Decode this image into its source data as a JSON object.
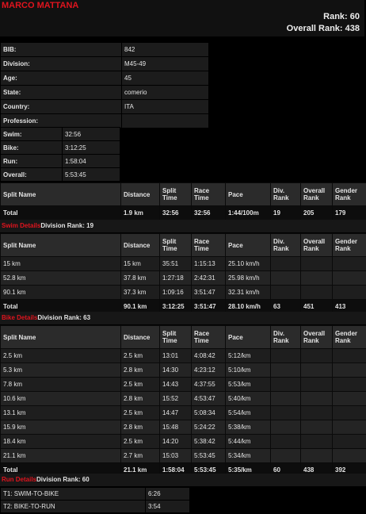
{
  "athlete": {
    "name": "MARCO MATTANA",
    "rank_label": "Rank: 60",
    "overall_rank_label": "Overall Rank: 438"
  },
  "info": [
    {
      "k": "BIB:",
      "v": "842"
    },
    {
      "k": "Division:",
      "v": "M45-49"
    },
    {
      "k": "Age:",
      "v": "45"
    },
    {
      "k": "State:",
      "v": "comerio"
    },
    {
      "k": "Country:",
      "v": "ITA"
    },
    {
      "k": "Profession:",
      "v": ""
    }
  ],
  "summary": [
    {
      "k": "Swim:",
      "v": "32:56"
    },
    {
      "k": "Bike:",
      "v": "3:12:25"
    },
    {
      "k": "Run:",
      "v": "1:58:04"
    },
    {
      "k": "Overall:",
      "v": "5:53:45"
    }
  ],
  "headers": {
    "split": "Split Name",
    "dist": "Distance",
    "stime": "Split Time",
    "rtime": "Race Time",
    "pace": "Pace",
    "div": "Div. Rank",
    "ovr": "Overall Rank",
    "gen": "Gender Rank"
  },
  "swim": {
    "rows": [],
    "total": [
      "Total",
      "1.9 km",
      "32:56",
      "32:56",
      "1:44/100m",
      "19",
      "205",
      "179"
    ]
  },
  "bike": {
    "link": "Swim Details",
    "division_rank": "Division Rank: 19",
    "rows": [
      [
        "15 km",
        "15 km",
        "35:51",
        "1:15:13",
        "25.10 km/h",
        "",
        "",
        ""
      ],
      [
        "52.8 km",
        "37.8 km",
        "1:27:18",
        "2:42:31",
        "25.98 km/h",
        "",
        "",
        ""
      ],
      [
        "90.1 km",
        "37.3 km",
        "1:09:16",
        "3:51:47",
        "32.31 km/h",
        "",
        "",
        ""
      ]
    ],
    "total": [
      "Total",
      "90.1 km",
      "3:12:25",
      "3:51:47",
      "28.10 km/h",
      "63",
      "451",
      "413"
    ]
  },
  "run": {
    "link": "Bike Details",
    "division_rank": "Division Rank: 63",
    "rows": [
      [
        "2.5 km",
        "2.5 km",
        "13:01",
        "4:08:42",
        "5:12/km",
        "",
        "",
        ""
      ],
      [
        "5.3 km",
        "2.8 km",
        "14:30",
        "4:23:12",
        "5:10/km",
        "",
        "",
        ""
      ],
      [
        "7.8 km",
        "2.5 km",
        "14:43",
        "4:37:55",
        "5:53/km",
        "",
        "",
        ""
      ],
      [
        "10.6 km",
        "2.8 km",
        "15:52",
        "4:53:47",
        "5:40/km",
        "",
        "",
        ""
      ],
      [
        "13.1 km",
        "2.5 km",
        "14:47",
        "5:08:34",
        "5:54/km",
        "",
        "",
        ""
      ],
      [
        "15.9 km",
        "2.8 km",
        "15:48",
        "5:24:22",
        "5:38/km",
        "",
        "",
        ""
      ],
      [
        "18.4 km",
        "2.5 km",
        "14:20",
        "5:38:42",
        "5:44/km",
        "",
        "",
        ""
      ],
      [
        "21.1 km",
        "2.7 km",
        "15:03",
        "5:53:45",
        "5:34/km",
        "",
        "",
        ""
      ]
    ],
    "total": [
      "Total",
      "21.1 km",
      "1:58:04",
      "5:53:45",
      "5:35/km",
      "60",
      "438",
      "392"
    ]
  },
  "run_details": {
    "link": "Run Details",
    "division_rank": "Division Rank: 60"
  },
  "transitions": [
    {
      "k": "T1: SWIM-TO-BIKE",
      "v": "6:26"
    },
    {
      "k": "T2: BIKE-TO-RUN",
      "v": "3:54"
    }
  ]
}
